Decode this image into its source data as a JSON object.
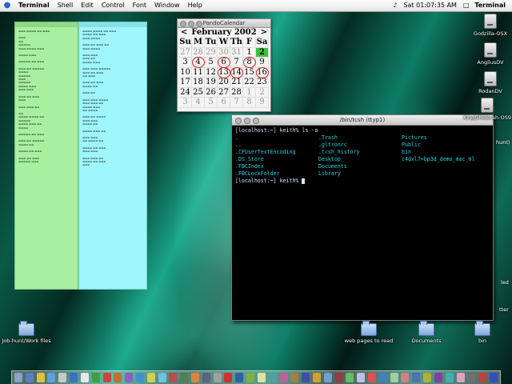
{
  "menubar": {
    "app": "Terminal",
    "items": [
      "Shell",
      "Edit",
      "Control",
      "Font",
      "Window",
      "Help"
    ],
    "clock": "Sat 01:07:35 AM",
    "right_app": "Terminal"
  },
  "calendar": {
    "window_title": "PandoCalendar",
    "prev": "<",
    "next": ">",
    "month_label": "February 2002",
    "weekdays": [
      "Su",
      "M",
      "Tu",
      "W",
      "Th",
      "F",
      "Sa"
    ],
    "days": [
      {
        "n": "27",
        "other": true
      },
      {
        "n": "28",
        "other": true
      },
      {
        "n": "29",
        "other": true
      },
      {
        "n": "30",
        "other": true
      },
      {
        "n": "31",
        "other": true
      },
      {
        "n": "1"
      },
      {
        "n": "2",
        "today": true
      },
      {
        "n": "3"
      },
      {
        "n": "4",
        "circled": true
      },
      {
        "n": "5"
      },
      {
        "n": "6",
        "circled": true
      },
      {
        "n": "7"
      },
      {
        "n": "8",
        "circled": true
      },
      {
        "n": "9"
      },
      {
        "n": "10"
      },
      {
        "n": "11"
      },
      {
        "n": "12"
      },
      {
        "n": "13",
        "circled": true
      },
      {
        "n": "14",
        "circled": true
      },
      {
        "n": "15"
      },
      {
        "n": "16",
        "circled": true
      },
      {
        "n": "17"
      },
      {
        "n": "18"
      },
      {
        "n": "19"
      },
      {
        "n": "20"
      },
      {
        "n": "21"
      },
      {
        "n": "22"
      },
      {
        "n": "23"
      },
      {
        "n": "24"
      },
      {
        "n": "25"
      },
      {
        "n": "26"
      },
      {
        "n": "27"
      },
      {
        "n": "28"
      },
      {
        "n": "1",
        "other": true
      },
      {
        "n": "2",
        "other": true
      },
      {
        "n": "3",
        "other": true
      },
      {
        "n": "4",
        "other": true
      },
      {
        "n": "5",
        "other": true
      },
      {
        "n": "6",
        "other": true
      },
      {
        "n": "7",
        "other": true
      },
      {
        "n": "8",
        "other": true
      },
      {
        "n": "9",
        "other": true
      }
    ]
  },
  "terminal": {
    "title": "/bin/tcsh  (ttyp1)",
    "prompt1": "[localhost:~] keith% ls -a",
    "files": [
      ".",
      ".Trash",
      "Pictures",
      "..",
      ".gltronrc",
      "Public",
      ".CFUserTextEncoding",
      ".tcsh_history",
      "bin",
      ".DS_Store",
      "Desktop",
      "c4dxl7+bp3d_demo_mac_ml",
      ".FBCIndex",
      "Documents",
      "",
      ".FBCLockFolder",
      "Library",
      ""
    ],
    "prompt2": "[localhost:~] keith% "
  },
  "desktop": {
    "drives": [
      "Godzilla-OSX",
      "AngilusDV",
      "RodanDV",
      "KingGhidorah-OS9"
    ],
    "folders": [
      "Job-hunt/Work files",
      "web pages to read",
      "Documents",
      "bin"
    ],
    "partial_labels": [
      "hunt)",
      "led",
      "tter"
    ]
  },
  "colors": {
    "sticky_green": "#a8f0a0",
    "sticky_cyan": "#9ff6fa",
    "terminal_bg": "#000000",
    "terminal_text": "#cfe8ff",
    "terminal_dir": "#2fd0e0",
    "today": "#3ec23e",
    "circle": "#e52020"
  }
}
